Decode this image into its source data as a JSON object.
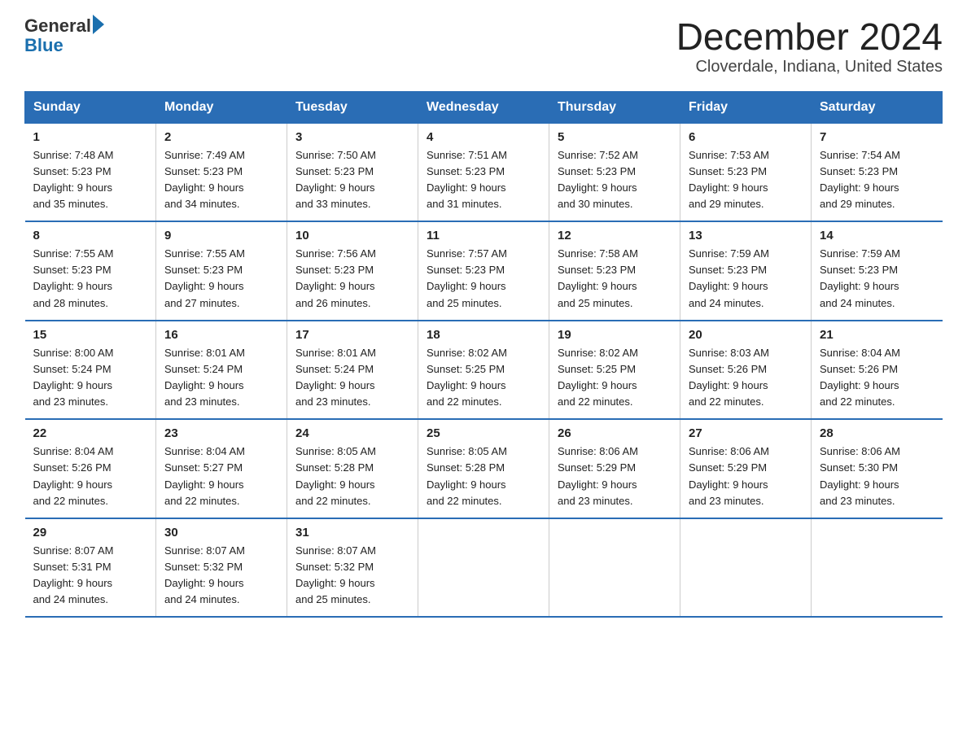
{
  "header": {
    "logo_general": "General",
    "logo_blue": "Blue",
    "title": "December 2024",
    "subtitle": "Cloverdale, Indiana, United States"
  },
  "days_of_week": [
    "Sunday",
    "Monday",
    "Tuesday",
    "Wednesday",
    "Thursday",
    "Friday",
    "Saturday"
  ],
  "weeks": [
    [
      {
        "num": "1",
        "sunrise": "7:48 AM",
        "sunset": "5:23 PM",
        "daylight": "9 hours and 35 minutes."
      },
      {
        "num": "2",
        "sunrise": "7:49 AM",
        "sunset": "5:23 PM",
        "daylight": "9 hours and 34 minutes."
      },
      {
        "num": "3",
        "sunrise": "7:50 AM",
        "sunset": "5:23 PM",
        "daylight": "9 hours and 33 minutes."
      },
      {
        "num": "4",
        "sunrise": "7:51 AM",
        "sunset": "5:23 PM",
        "daylight": "9 hours and 31 minutes."
      },
      {
        "num": "5",
        "sunrise": "7:52 AM",
        "sunset": "5:23 PM",
        "daylight": "9 hours and 30 minutes."
      },
      {
        "num": "6",
        "sunrise": "7:53 AM",
        "sunset": "5:23 PM",
        "daylight": "9 hours and 29 minutes."
      },
      {
        "num": "7",
        "sunrise": "7:54 AM",
        "sunset": "5:23 PM",
        "daylight": "9 hours and 29 minutes."
      }
    ],
    [
      {
        "num": "8",
        "sunrise": "7:55 AM",
        "sunset": "5:23 PM",
        "daylight": "9 hours and 28 minutes."
      },
      {
        "num": "9",
        "sunrise": "7:55 AM",
        "sunset": "5:23 PM",
        "daylight": "9 hours and 27 minutes."
      },
      {
        "num": "10",
        "sunrise": "7:56 AM",
        "sunset": "5:23 PM",
        "daylight": "9 hours and 26 minutes."
      },
      {
        "num": "11",
        "sunrise": "7:57 AM",
        "sunset": "5:23 PM",
        "daylight": "9 hours and 25 minutes."
      },
      {
        "num": "12",
        "sunrise": "7:58 AM",
        "sunset": "5:23 PM",
        "daylight": "9 hours and 25 minutes."
      },
      {
        "num": "13",
        "sunrise": "7:59 AM",
        "sunset": "5:23 PM",
        "daylight": "9 hours and 24 minutes."
      },
      {
        "num": "14",
        "sunrise": "7:59 AM",
        "sunset": "5:23 PM",
        "daylight": "9 hours and 24 minutes."
      }
    ],
    [
      {
        "num": "15",
        "sunrise": "8:00 AM",
        "sunset": "5:24 PM",
        "daylight": "9 hours and 23 minutes."
      },
      {
        "num": "16",
        "sunrise": "8:01 AM",
        "sunset": "5:24 PM",
        "daylight": "9 hours and 23 minutes."
      },
      {
        "num": "17",
        "sunrise": "8:01 AM",
        "sunset": "5:24 PM",
        "daylight": "9 hours and 23 minutes."
      },
      {
        "num": "18",
        "sunrise": "8:02 AM",
        "sunset": "5:25 PM",
        "daylight": "9 hours and 22 minutes."
      },
      {
        "num": "19",
        "sunrise": "8:02 AM",
        "sunset": "5:25 PM",
        "daylight": "9 hours and 22 minutes."
      },
      {
        "num": "20",
        "sunrise": "8:03 AM",
        "sunset": "5:26 PM",
        "daylight": "9 hours and 22 minutes."
      },
      {
        "num": "21",
        "sunrise": "8:04 AM",
        "sunset": "5:26 PM",
        "daylight": "9 hours and 22 minutes."
      }
    ],
    [
      {
        "num": "22",
        "sunrise": "8:04 AM",
        "sunset": "5:26 PM",
        "daylight": "9 hours and 22 minutes."
      },
      {
        "num": "23",
        "sunrise": "8:04 AM",
        "sunset": "5:27 PM",
        "daylight": "9 hours and 22 minutes."
      },
      {
        "num": "24",
        "sunrise": "8:05 AM",
        "sunset": "5:28 PM",
        "daylight": "9 hours and 22 minutes."
      },
      {
        "num": "25",
        "sunrise": "8:05 AM",
        "sunset": "5:28 PM",
        "daylight": "9 hours and 22 minutes."
      },
      {
        "num": "26",
        "sunrise": "8:06 AM",
        "sunset": "5:29 PM",
        "daylight": "9 hours and 23 minutes."
      },
      {
        "num": "27",
        "sunrise": "8:06 AM",
        "sunset": "5:29 PM",
        "daylight": "9 hours and 23 minutes."
      },
      {
        "num": "28",
        "sunrise": "8:06 AM",
        "sunset": "5:30 PM",
        "daylight": "9 hours and 23 minutes."
      }
    ],
    [
      {
        "num": "29",
        "sunrise": "8:07 AM",
        "sunset": "5:31 PM",
        "daylight": "9 hours and 24 minutes."
      },
      {
        "num": "30",
        "sunrise": "8:07 AM",
        "sunset": "5:32 PM",
        "daylight": "9 hours and 24 minutes."
      },
      {
        "num": "31",
        "sunrise": "8:07 AM",
        "sunset": "5:32 PM",
        "daylight": "9 hours and 25 minutes."
      },
      null,
      null,
      null,
      null
    ]
  ],
  "labels": {
    "sunrise": "Sunrise:",
    "sunset": "Sunset:",
    "daylight": "Daylight:"
  }
}
